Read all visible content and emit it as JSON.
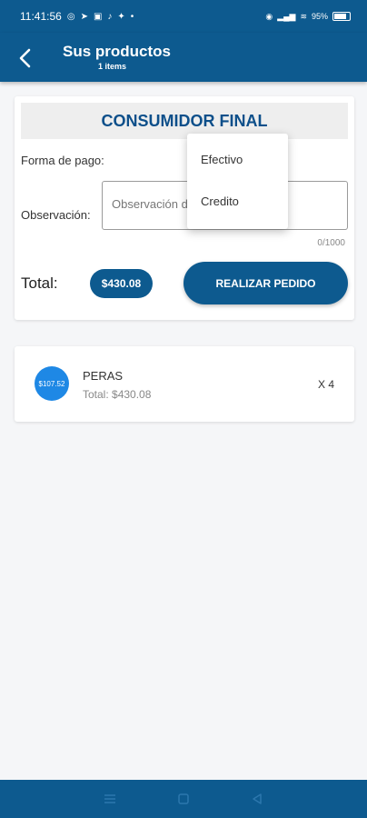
{
  "status_bar": {
    "time": "11:41:56",
    "battery": "95%"
  },
  "app_bar": {
    "title": "Sus productos",
    "subtitle": "1 items"
  },
  "order": {
    "customer": "CONSUMIDOR FINAL",
    "payment_label": "Forma de pago:",
    "observation_label": "Observación:",
    "observation_placeholder": "Observación d",
    "char_count": "0/1000",
    "total_label": "Total:",
    "total_value": "$430.08",
    "order_button": "REALIZAR PEDIDO"
  },
  "payment_dropdown": {
    "options": [
      "Efectivo",
      "Credito"
    ]
  },
  "products": [
    {
      "price": "$107.52",
      "name": "PERAS",
      "total": "Total: $430.08",
      "quantity": "X 4"
    }
  ],
  "colors": {
    "primary": "#0d5a8f",
    "accent": "#1e88e5",
    "header_text": "#0d4f8a"
  }
}
